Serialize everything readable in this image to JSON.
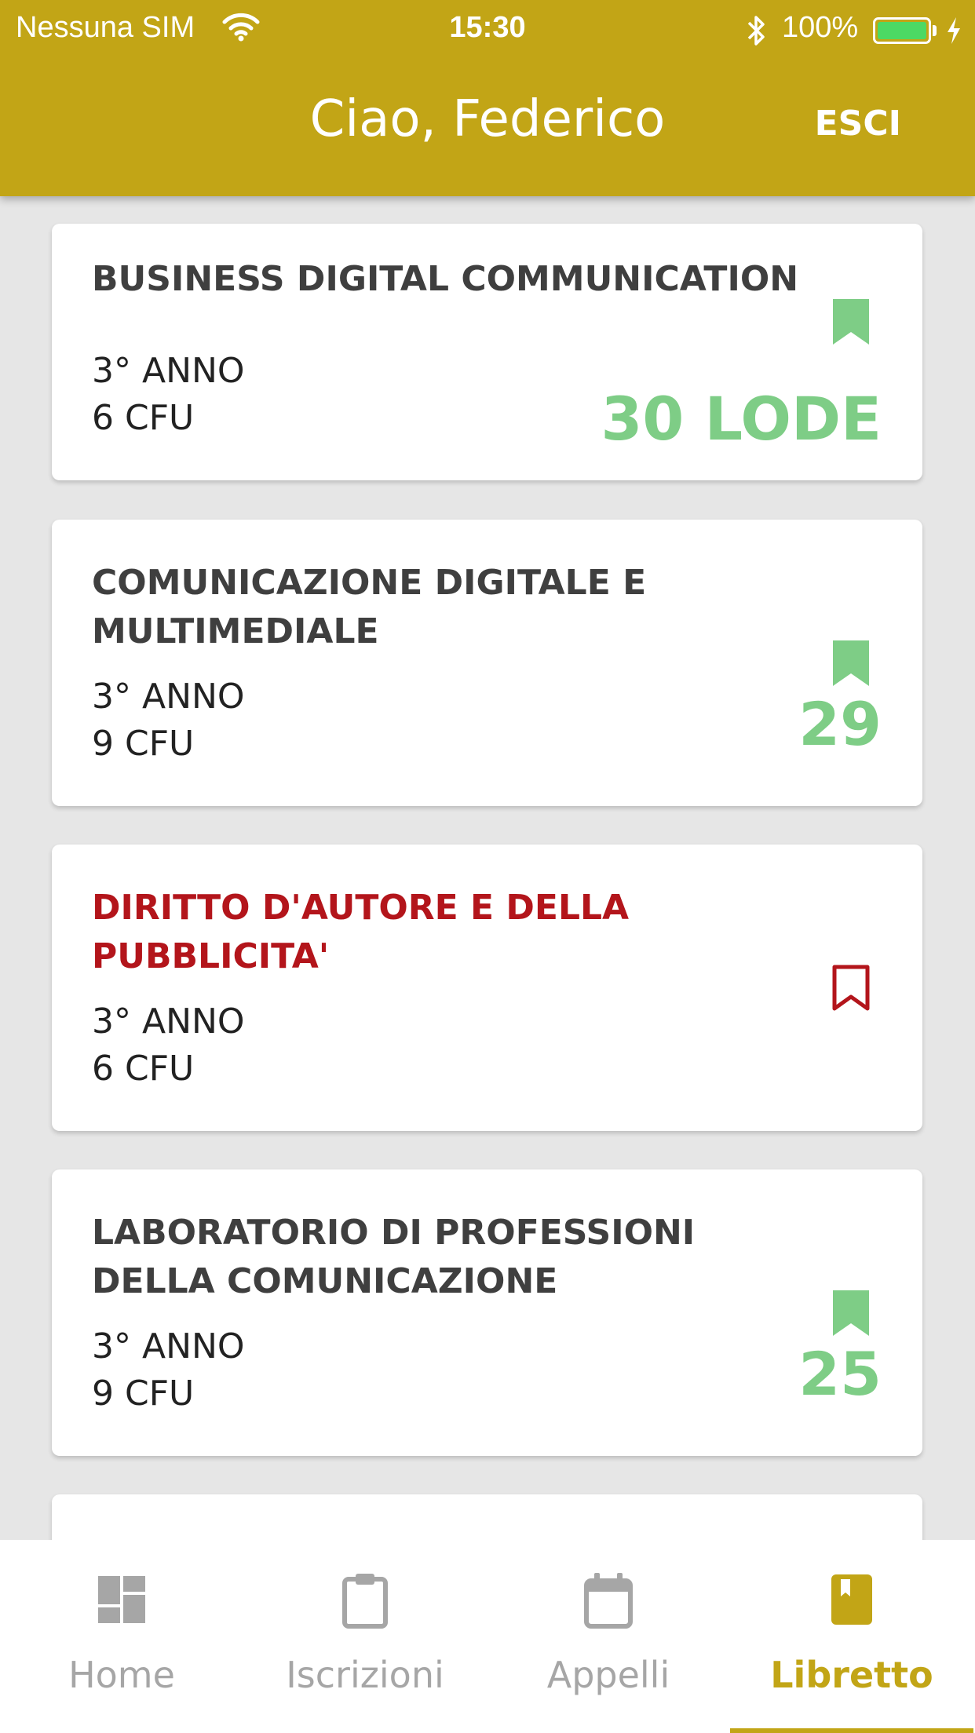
{
  "status_bar": {
    "carrier": "Nessuna SIM",
    "time": "15:30",
    "battery": "100%"
  },
  "header": {
    "title": "Ciao, Federico",
    "logout_label": "ESCI",
    "color": "#c2a516"
  },
  "courses": [
    {
      "name": "BUSINESS DIGITAL COMMUNICATION",
      "year": "3° ANNO",
      "credits": "6 CFU",
      "grade": "30 LODE",
      "passed": true
    },
    {
      "name": "COMUNICAZIONE DIGITALE E MULTIMEDIALE",
      "year": "3° ANNO",
      "credits": "9 CFU",
      "grade": "29",
      "passed": true
    },
    {
      "name": "DIRITTO D'AUTORE E DELLA PUBBLICITA'",
      "year": "3° ANNO",
      "credits": "6 CFU",
      "grade": "",
      "passed": false
    },
    {
      "name": "LABORATORIO DI PROFESSIONI DELLA COMUNICAZIONE",
      "year": "3° ANNO",
      "credits": "9 CFU",
      "grade": "25",
      "passed": true
    }
  ],
  "colors": {
    "passed": "#7ecd86",
    "failed": "#b3151b",
    "accent": "#c2a516"
  },
  "tabs": [
    {
      "label": "Home",
      "icon": "dashboard-icon",
      "active": false
    },
    {
      "label": "Iscrizioni",
      "icon": "clipboard-icon",
      "active": false
    },
    {
      "label": "Appelli",
      "icon": "calendar-icon",
      "active": false
    },
    {
      "label": "Libretto",
      "icon": "book-icon",
      "active": true
    }
  ]
}
